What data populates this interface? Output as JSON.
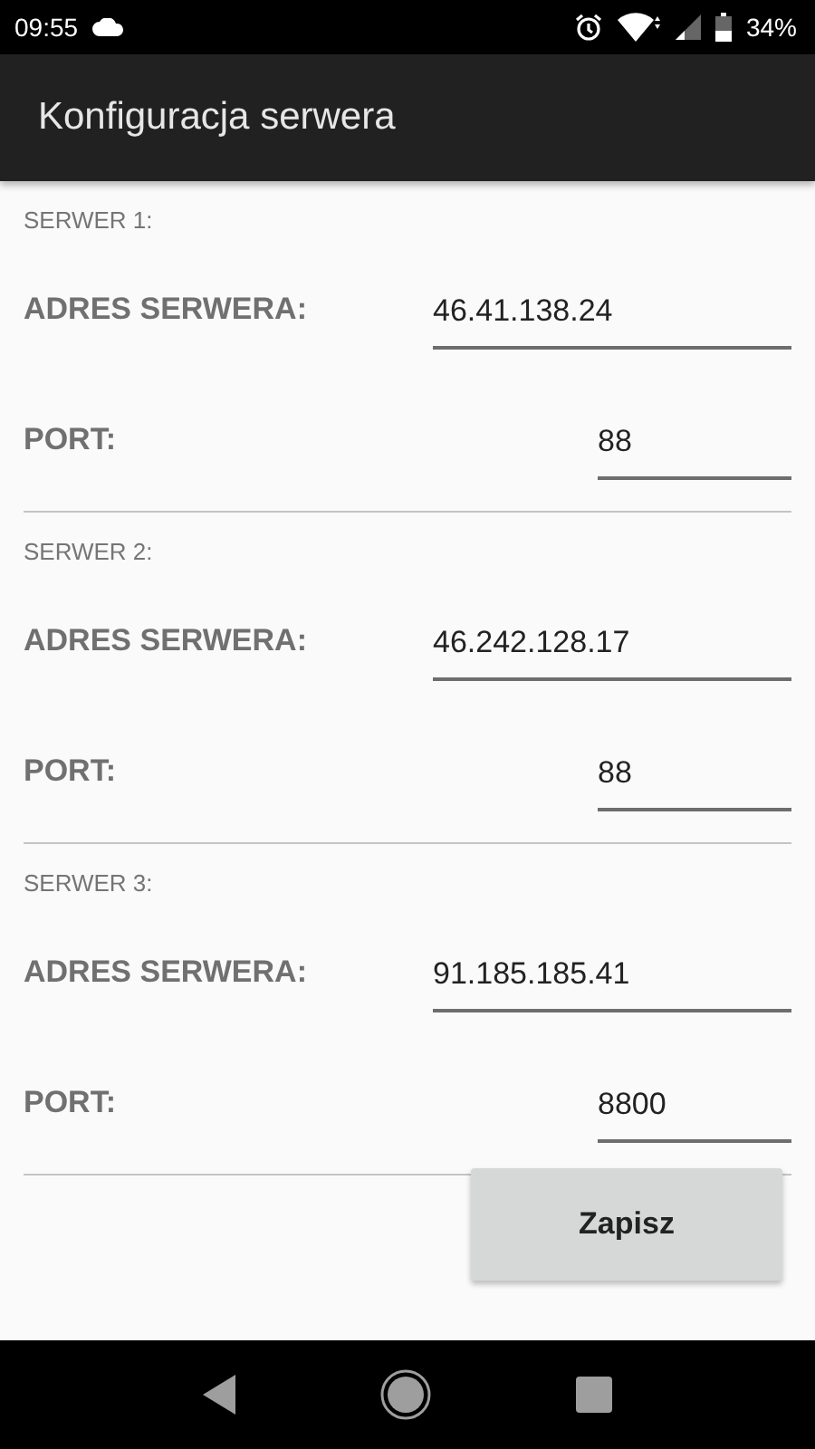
{
  "status_bar": {
    "time": "09:55",
    "battery": "34%"
  },
  "app_bar": {
    "title": "Konfiguracja serwera"
  },
  "servers": [
    {
      "heading": "SERWER 1:",
      "address_label": "ADRES SERWERA:",
      "address": "46.41.138.24",
      "port_label": "PORT:",
      "port": "88"
    },
    {
      "heading": "SERWER 2:",
      "address_label": "ADRES SERWERA:",
      "address": "46.242.128.17",
      "port_label": "PORT:",
      "port": "88"
    },
    {
      "heading": "SERWER 3:",
      "address_label": "ADRES SERWERA:",
      "address": "91.185.185.41",
      "port_label": "PORT:",
      "port": "8800"
    }
  ],
  "save_button": "Zapisz"
}
